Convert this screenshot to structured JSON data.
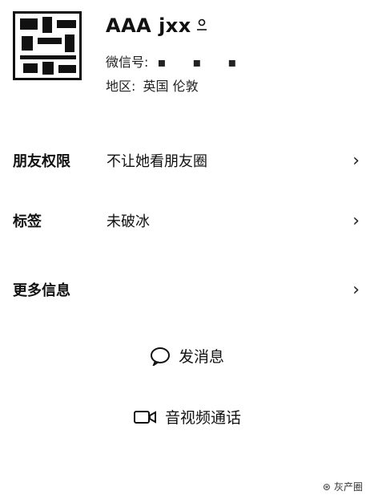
{
  "profile": {
    "name": "AAA jxx",
    "gender_icon": "person-icon",
    "wechat_id_label": "微信号:",
    "wechat_id_value": "▪ ▪ ▪",
    "region_label": "地区:",
    "region_value": "英国 伦敦"
  },
  "rows": [
    {
      "label": "朋友权限",
      "value": "不让她看朋友圈"
    },
    {
      "label": "标签",
      "value": "未破冰"
    },
    {
      "label": "更多信息",
      "value": ""
    }
  ],
  "actions": {
    "message": "发消息",
    "call": "音视频通话"
  },
  "watermark": "灰产圈"
}
